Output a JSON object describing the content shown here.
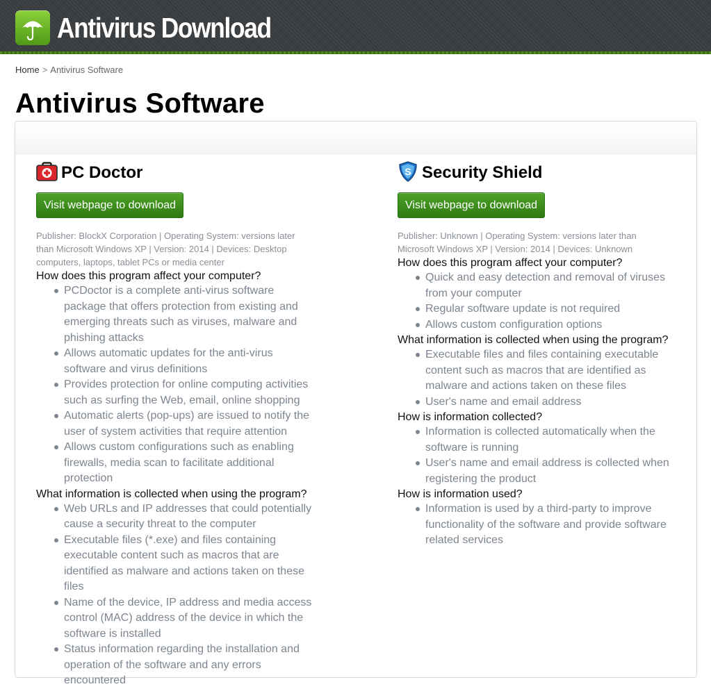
{
  "header": {
    "site_title": "Antivirus Download",
    "logo_icon": "umbrella-icon"
  },
  "breadcrumb": {
    "home": "Home",
    "separator": ">",
    "current": "Antivirus Software"
  },
  "page_title": "Antivirus Software",
  "colors": {
    "header_bg": "#3a3d40",
    "accent_green": "#3c8a1c",
    "muted_text": "#7d8590"
  },
  "products": [
    {
      "name": "PC Doctor",
      "icon": "medical-kit-icon",
      "button_label": "Visit webpage to download",
      "meta": "Publisher: BlockX Corporation | Operating System: versions later than Microsoft Windows XP | Version: 2014 | Devices: Desktop computers, laptops, tablet PCs or media center",
      "sections": [
        {
          "question": "How does this program affect your computer?",
          "answers": [
            "PCDoctor is a complete anti-virus software package that offers protection from existing and emerging threats such as viruses, malware and phishing attacks",
            "Allows automatic updates for the anti-virus software and virus definitions",
            "Provides protection for online computing activities such as surfing the Web, email, online shopping",
            "Automatic alerts (pop-ups) are issued to notify the user of system activities that require attention",
            "Allows custom configurations such as enabling firewalls, media scan to facilitate additional protection"
          ]
        },
        {
          "question": "What information is collected when using the program?",
          "answers": [
            "Web URLs and IP addresses that could potentially cause a security threat to the computer",
            "Executable files (*.exe) and files containing executable content such as macros that are identified as malware and actions taken on these files",
            "Name of the device, IP address and media access control (MAC) address of the device in which the software is installed",
            "Status information regarding the installation and operation of the software and any errors encountered"
          ]
        }
      ]
    },
    {
      "name": "Security Shield",
      "icon": "shield-icon",
      "button_label": "Visit webpage to download",
      "meta": "Publisher: Unknown | Operating System: versions later than Microsoft Windows XP | Version: 2014 | Devices: Unknown",
      "sections": [
        {
          "question": "How does this program affect your computer?",
          "answers": [
            "Quick and easy detection and removal of viruses from your computer",
            "Regular software update is not required",
            "Allows custom configuration options"
          ]
        },
        {
          "question": "What information is collected when using the program?",
          "answers": [
            "Executable files and files containing executable content such as macros that are identified as malware and actions taken on these files",
            "User's name and email address"
          ]
        },
        {
          "question": "How is information collected?",
          "answers": [
            "Information is collected automatically when the software is running",
            "User's name and email address is collected when registering the product"
          ]
        },
        {
          "question": "How is information used?",
          "answers": [
            "Information is used by a third-party to improve functionality of the software and provide software related services"
          ]
        }
      ]
    }
  ]
}
